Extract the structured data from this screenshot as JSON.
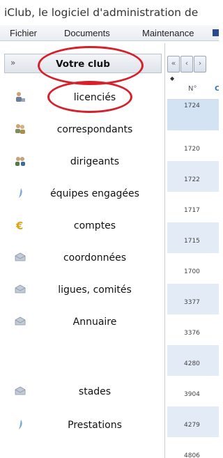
{
  "window": {
    "title": "iClub, le logiciel d'administration de",
    "ghost_title": "iClub, le logiciel d'administration de"
  },
  "menubar": {
    "items": [
      "Fichier",
      "Documents",
      "Maintenance"
    ]
  },
  "sidebar": {
    "header": "Votre club",
    "items": [
      {
        "label": "licenciés",
        "icon": "person-icon"
      },
      {
        "label": "correspondants",
        "icon": "people-icon"
      },
      {
        "label": "dirigeants",
        "icon": "group-icon"
      },
      {
        "label": "équipes engagées",
        "icon": "pennant-icon"
      },
      {
        "label": "comptes",
        "icon": "euro-icon"
      },
      {
        "label": "coordonnées",
        "icon": "envelope-icon"
      },
      {
        "label": "ligues, comités",
        "icon": "envelope-icon"
      },
      {
        "label": "Annuaire",
        "icon": "envelope-icon"
      },
      {
        "label": "stades",
        "icon": "envelope-icon"
      },
      {
        "label": "Prestations",
        "icon": "pennant-icon"
      }
    ]
  },
  "grid": {
    "pager": [
      "«",
      "‹",
      "›"
    ],
    "columns": [
      "N°",
      "C"
    ],
    "rows": [
      "1724",
      "1720",
      "1722",
      "1717",
      "1715",
      "1700",
      "3377",
      "3376",
      "4280",
      "3904",
      "4279",
      "4806"
    ]
  },
  "colors": {
    "annotation": "#d8202b",
    "row_alt": "#e3ecf6",
    "accent": "#3a6fb5"
  }
}
